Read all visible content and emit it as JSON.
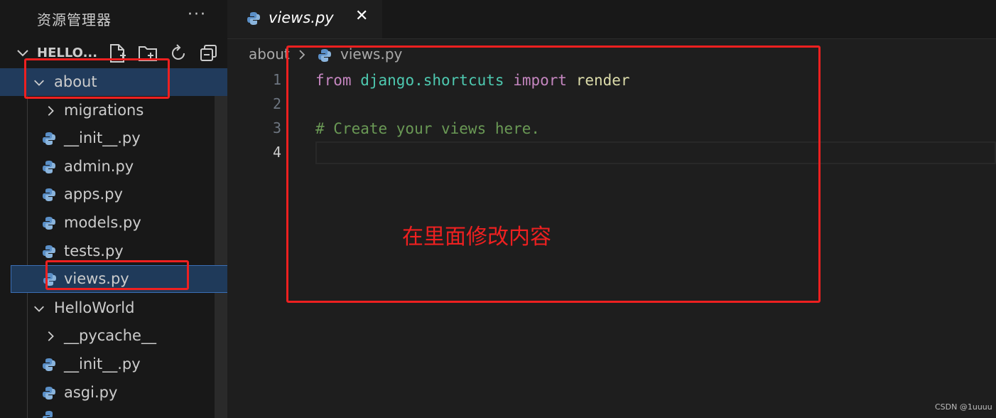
{
  "explorer": {
    "title": "资源管理器",
    "more": "···",
    "folder_name": "HELLO...",
    "toolbar_icons": [
      "new-file-icon",
      "new-folder-icon",
      "refresh-icon",
      "collapse-all-icon"
    ]
  },
  "tree": [
    {
      "label": "about",
      "type": "folder",
      "expanded": true
    },
    {
      "label": "migrations",
      "type": "folder",
      "expanded": false
    },
    {
      "label": "__init__.py",
      "type": "file"
    },
    {
      "label": "admin.py",
      "type": "file"
    },
    {
      "label": "apps.py",
      "type": "file"
    },
    {
      "label": "models.py",
      "type": "file"
    },
    {
      "label": "tests.py",
      "type": "file"
    },
    {
      "label": "views.py",
      "type": "file",
      "selected": true
    },
    {
      "label": "HelloWorld",
      "type": "folder",
      "expanded": true
    },
    {
      "label": "__pycache__",
      "type": "folder",
      "expanded": false
    },
    {
      "label": "__init__.py",
      "type": "file"
    },
    {
      "label": "asgi.py",
      "type": "file"
    }
  ],
  "tab": {
    "label": "views.py",
    "close": "✕"
  },
  "breadcrumb": {
    "folder": "about",
    "file": "views.py"
  },
  "editor": {
    "line_numbers": [
      "1",
      "2",
      "3",
      "4"
    ],
    "line1": {
      "kw_from": "from",
      "module": "django.shortcuts",
      "kw_import": "import",
      "name": "render"
    },
    "line3": "# Create your views here."
  },
  "annotation": {
    "text": "在里面修改内容"
  },
  "watermark": "CSDN @1uuuu",
  "colors": {
    "annotation": "#ee2020",
    "keyword": "#c586c0",
    "module": "#4ec9b0",
    "function": "#dcdcaa",
    "comment": "#6a9955",
    "selection": "#213b5c"
  }
}
